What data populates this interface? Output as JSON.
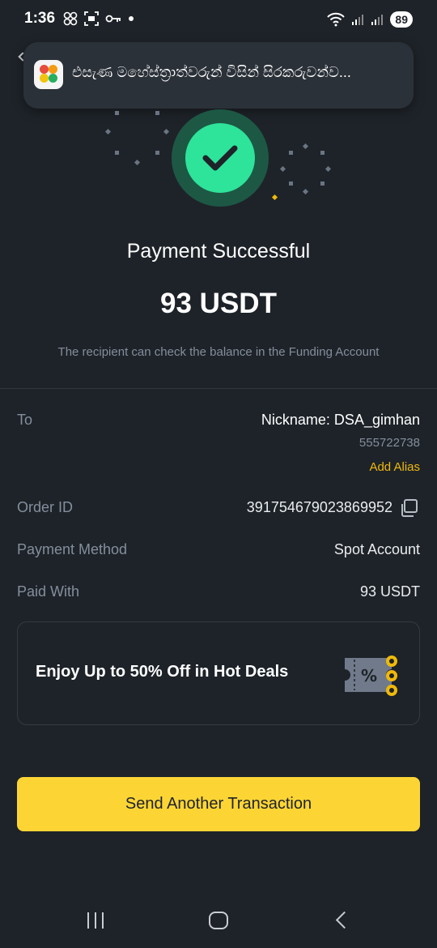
{
  "status_bar": {
    "time": "1:36",
    "battery": "89",
    "icons": [
      "gallery-icon",
      "screenshot-icon",
      "key-icon",
      "dot-icon",
      "wifi-icon",
      "signal-icon",
      "signal-icon"
    ]
  },
  "notification": {
    "app_icon": "app-icon",
    "text": "එසැණ මහේස්ත්‍රාත්වරුන් විසින් සිරකරුවන්ව..."
  },
  "success": {
    "icon": "checkmark-icon",
    "title": "Payment Successful",
    "amount": "93 USDT",
    "subtitle": "The recipient can check the balance in the Funding Account"
  },
  "details": {
    "to_label": "To",
    "nickname": "Nickname: DSA_gimhan",
    "uid": "555722738",
    "add_alias": "Add Alias",
    "order_id_label": "Order ID",
    "order_id": "391754679023869952",
    "payment_method_label": "Payment Method",
    "payment_method": "Spot Account",
    "paid_with_label": "Paid With",
    "paid_with": "93 USDT"
  },
  "promo": {
    "text": "Enjoy Up to 50% Off in Hot Deals",
    "icon": "coupon-icon"
  },
  "cta": {
    "label": "Send Another Transaction"
  },
  "colors": {
    "background": "#1e2329",
    "accent_yellow": "#fcd535",
    "success_green": "#2ee39a",
    "alias_yellow": "#f0b90b",
    "muted_text": "#848e9c"
  }
}
